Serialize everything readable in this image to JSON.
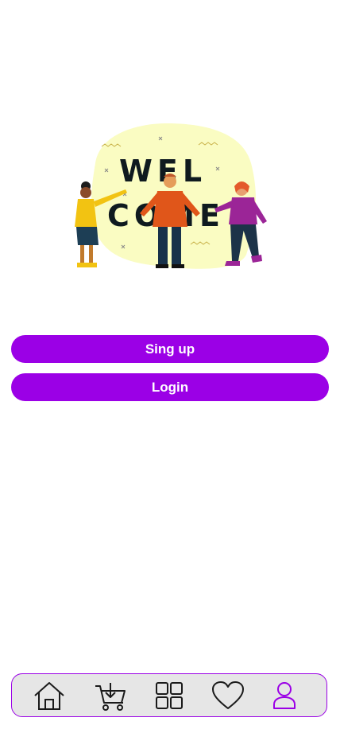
{
  "hero": {
    "welcome_line1": "WEL",
    "welcome_line2": "COME"
  },
  "buttons": {
    "signup_label": "Sing up",
    "login_label": "Login"
  },
  "nav": {
    "items": [
      {
        "icon": "home-icon",
        "active": false
      },
      {
        "icon": "cart-download-icon",
        "active": false
      },
      {
        "icon": "grid-icon",
        "active": false
      },
      {
        "icon": "heart-icon",
        "active": false
      },
      {
        "icon": "profile-icon",
        "active": true
      }
    ]
  },
  "colors": {
    "accent": "#9b00e6",
    "nav_background": "#e6e6e6",
    "icon_default": "#1a1a1a",
    "hero_blob": "#fafcc2"
  }
}
